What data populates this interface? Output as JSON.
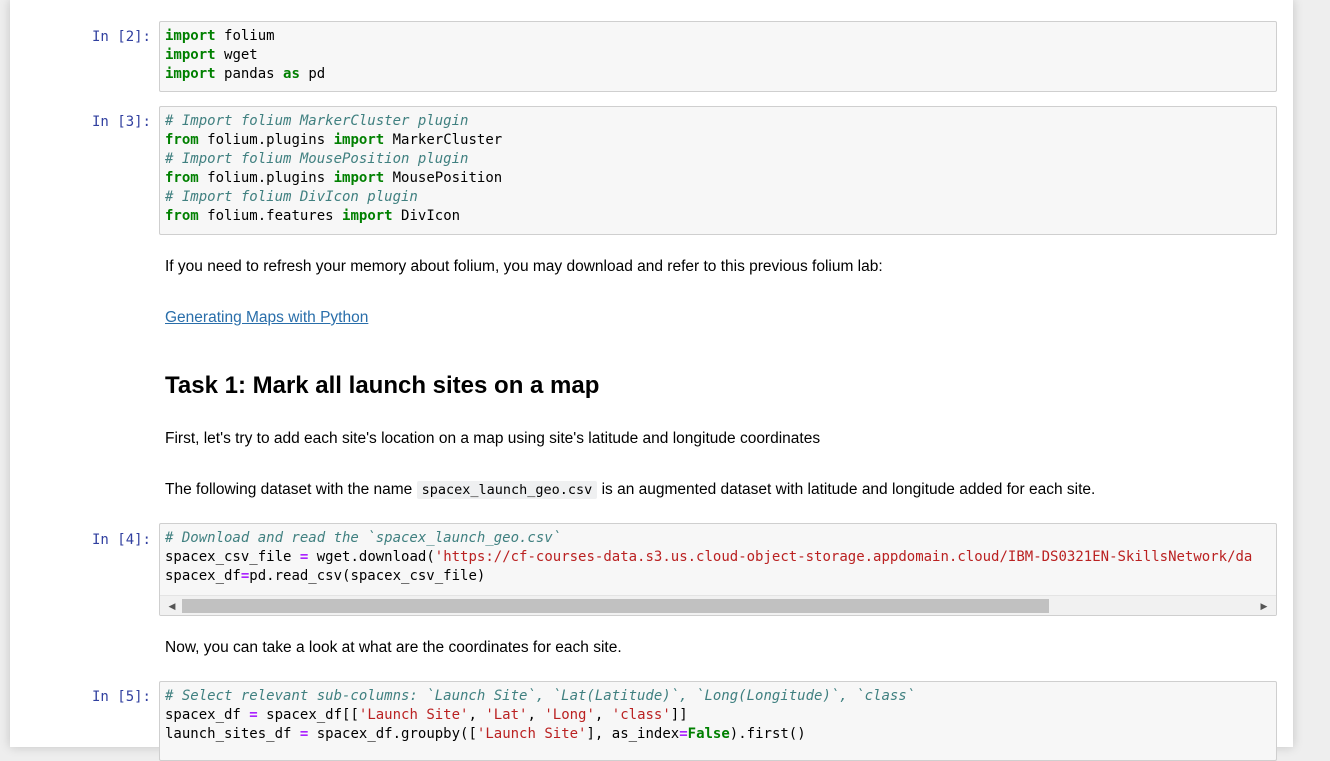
{
  "cells": [
    {
      "prompt": "In [2]:",
      "lines": [
        "import folium",
        "import wget",
        "import pandas as pd"
      ]
    },
    {
      "prompt": "In [3]:",
      "lines": [
        "# Import folium MarkerCluster plugin",
        "from folium.plugins import MarkerCluster",
        "# Import folium MousePosition plugin",
        "from folium.plugins import MousePosition",
        "# Import folium DivIcon plugin",
        "from folium.features import DivIcon"
      ]
    },
    {
      "prompt": "In [4]:",
      "lines": [
        "# Download and read the `spacex_launch_geo.csv`",
        "spacex_csv_file = wget.download('https://cf-courses-data.s3.us.cloud-object-storage.appdomain.cloud/IBM-DS0321EN-SkillsNetwork/da",
        "spacex_df=pd.read_csv(spacex_csv_file)"
      ]
    },
    {
      "prompt": "In [5]:",
      "lines": [
        "# Select relevant sub-columns: `Launch Site`, `Lat(Latitude)`, `Long(Longitude)`, `class`",
        "spacex_df = spacex_df[['Launch Site', 'Lat', 'Long', 'class']]",
        "launch_sites_df = spacex_df.groupby(['Launch Site'], as_index=False).first()"
      ]
    }
  ],
  "markdown": {
    "refresh_text": "If you need to refresh your memory about folium, you may download and refer to this previous folium lab:",
    "link_text": "Generating Maps with Python",
    "task_heading": "Task 1: Mark all launch sites on a map",
    "first_text": "First, let's try to add each site's location on a map using site's latitude and longitude coordinates",
    "dataset_prefix": "The following dataset with the name",
    "dataset_code": "spacex_launch_geo.csv",
    "dataset_suffix": "is an augmented dataset with latitude and longitude added for each site.",
    "coords_text": "Now, you can take a look at what are the coordinates for each site."
  },
  "scrollbar": {
    "left_arrow": "◀",
    "right_arrow": "▶"
  }
}
